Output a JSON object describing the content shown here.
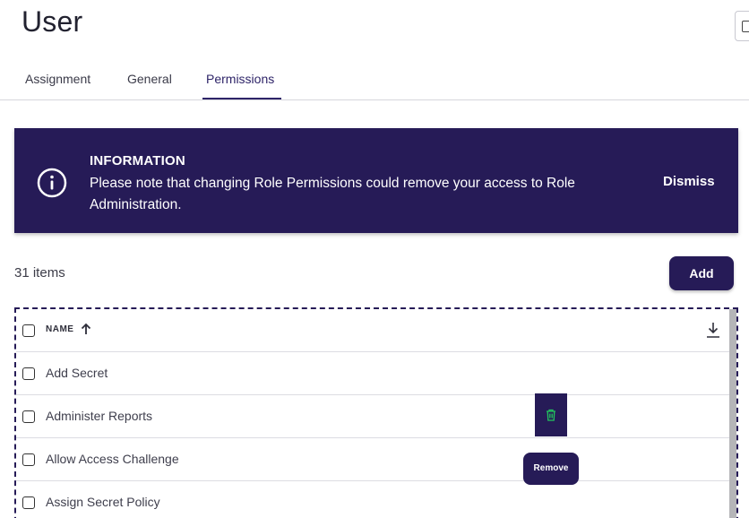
{
  "page": {
    "title": "User"
  },
  "tabs": [
    {
      "label": "Assignment"
    },
    {
      "label": "General"
    },
    {
      "label": "Permissions",
      "active": true
    }
  ],
  "banner": {
    "icon": "info-circle-icon",
    "title": "INFORMATION",
    "message": "Please note that changing Role Permissions could remove your access to Role Administration.",
    "dismiss_label": "Dismiss",
    "background": "#261b57"
  },
  "list": {
    "count_label": "31 items",
    "add_label": "Add",
    "column_name": "NAME",
    "sort": "ascending",
    "rows": [
      {
        "name": "Add Secret"
      },
      {
        "name": "Administer Reports"
      },
      {
        "name": "Allow Access Challenge"
      },
      {
        "name": "Assign Secret Policy"
      }
    ]
  },
  "row_actions": {
    "delete_icon": "trash-icon",
    "tooltip": "Remove",
    "icon_color": "#22c55e"
  },
  "colors": {
    "accent": "#261b57",
    "active_tab": "#2e2468"
  }
}
